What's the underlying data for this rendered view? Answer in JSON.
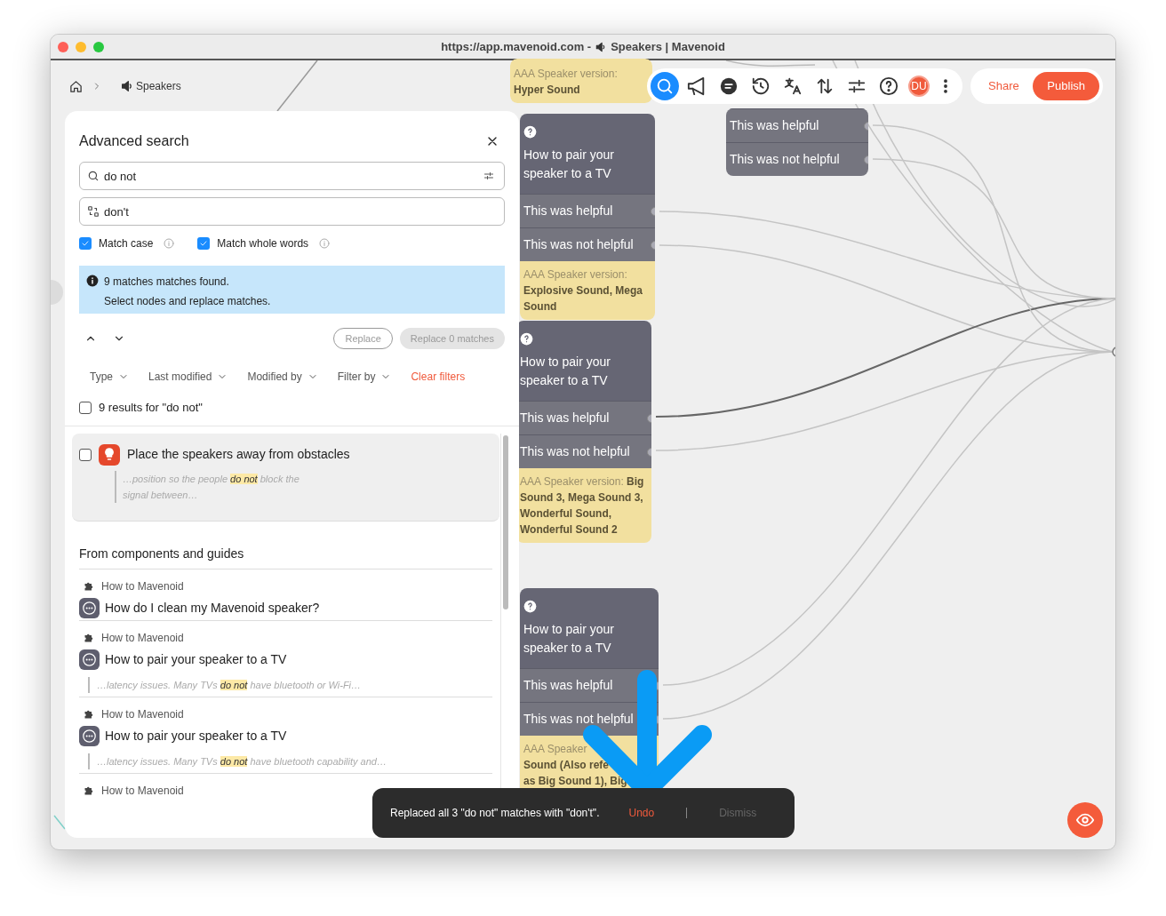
{
  "window": {
    "url": "https://app.mavenoid.com -",
    "title": "Speakers | Mavenoid"
  },
  "breadcrumb": {
    "current": "Speakers"
  },
  "toolbar": {
    "tools": [
      {
        "kind": "search",
        "selected": true
      },
      {
        "kind": "megaphone",
        "selected": false
      },
      {
        "kind": "comments",
        "selected": false
      },
      {
        "kind": "history",
        "selected": false
      },
      {
        "kind": "translate",
        "selected": false
      },
      {
        "kind": "sort",
        "selected": false
      },
      {
        "kind": "sliders",
        "selected": false
      },
      {
        "kind": "help",
        "selected": false
      }
    ],
    "avatar": "DU",
    "share": "Share",
    "publish": "Publish"
  },
  "search_panel": {
    "title": "Advanced search",
    "search_value": "do not",
    "replace_value": "don't",
    "options": [
      {
        "label": "Match case",
        "checked": true
      },
      {
        "label": "Match whole words",
        "checked": true
      }
    ],
    "alert": {
      "title": "9 matches matches found.",
      "body": "Select nodes and replace matches."
    },
    "buttons": [
      {
        "label": "Replace",
        "kind": "outline",
        "disabled": true
      },
      {
        "label": "Replace 0 matches",
        "kind": "filled",
        "disabled": true
      }
    ],
    "filters": [
      "Type",
      "Last modified",
      "Modified by",
      "Filter by"
    ],
    "clear_filters": "Clear filters",
    "select_all": {
      "label": "9 results for \"do not\"",
      "checked": false
    },
    "results": [
      {
        "title": "Place the speakers away from obstacles",
        "checked": false,
        "snippet": "…position so the people **do not** block the signal between…"
      }
    ],
    "section": "From components and guides",
    "guides": [
      {
        "source": "How to Mavenoid",
        "title": "How do I clean my Mavenoid speaker?"
      },
      {
        "source": "How to Mavenoid",
        "title": "How to pair your speaker to a TV",
        "snippet": "…latency issues. Many TVs **do not** have bluetooth or Wi-Fi…"
      },
      {
        "source": "How to Mavenoid",
        "title": "How to pair your speaker to a TV",
        "snippet": "…latency issues. Many TVs **do not** have bluetooth capability and…"
      },
      {
        "source": "How to Mavenoid"
      }
    ]
  },
  "canvas": {
    "nodes": [
      {
        "condition": {
          "label": "AAA Speaker version:",
          "value": "Hyper Sound"
        }
      },
      {
        "title": "How to pair your speaker to a TV",
        "answers": [
          "This was helpful",
          "This was not helpful"
        ],
        "condition": {
          "label": "AAA Speaker version:",
          "value": "Explosive Sound, Mega Sound"
        }
      },
      {
        "title": "How to pair your speaker to a TV",
        "answers": [
          "This was helpful",
          "This was not helpful"
        ],
        "condition": {
          "label": "AAA Speaker version:",
          "value": "Big Sound 3, Mega Sound 3, Wonderful Sound, Wonderful Sound 2"
        }
      },
      {
        "title": "How to pair your speaker to a TV",
        "answers": [
          "This was helpful",
          "This was not helpful"
        ],
        "condition": {
          "label": "AAA Speaker",
          "value_lines": [
            "Sound (Also refe",
            "as Big Sound 1), Big"
          ]
        }
      },
      {
        "answers": [
          "This was helpful",
          "This was not helpful"
        ]
      }
    ]
  },
  "toast": {
    "message": "Replaced all 3 \"do not\" matches with \"don't\".",
    "undo": "Undo",
    "dismiss": "Dismiss"
  }
}
